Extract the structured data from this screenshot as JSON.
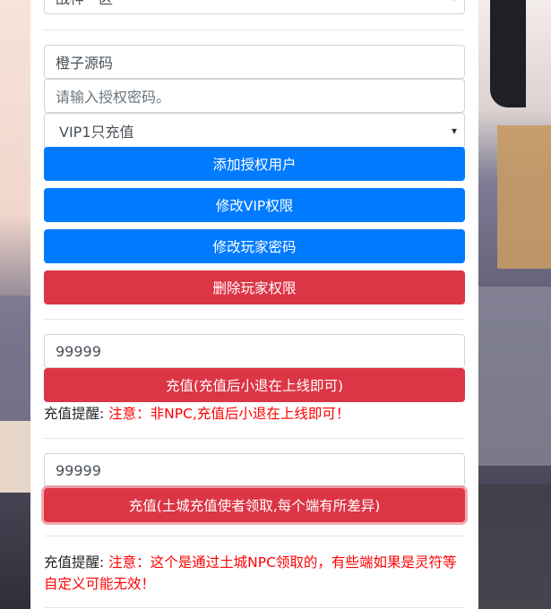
{
  "server_select": {
    "value": "战神一区"
  },
  "auth_form": {
    "username_value": "橙子源码",
    "password_placeholder": "请输入授权密码。",
    "vip_select_value": "VIP1只充值",
    "add_button": "添加授权用户",
    "modify_vip_button": "修改VIP权限",
    "modify_password_button": "修改玩家密码",
    "delete_button": "删除玩家权限"
  },
  "recharge1": {
    "amount_value": "99999",
    "button": "充值(充值后小退在上线即可)",
    "tip_label": "充值提醒:",
    "tip_text": "注意：非NPC,充值后小退在上线即可！"
  },
  "recharge2": {
    "amount_value": "99999",
    "button": "充值(土城充值使者领取,每个端有所差异)",
    "tip_label": "充值提醒:",
    "tip_text": "注意：这个是通过土城NPC领取的，有些端如果是灵符等自定义可能无效！"
  },
  "colors": {
    "primary": "#007bff",
    "danger": "#dc3545",
    "tip": "#ff0000"
  }
}
